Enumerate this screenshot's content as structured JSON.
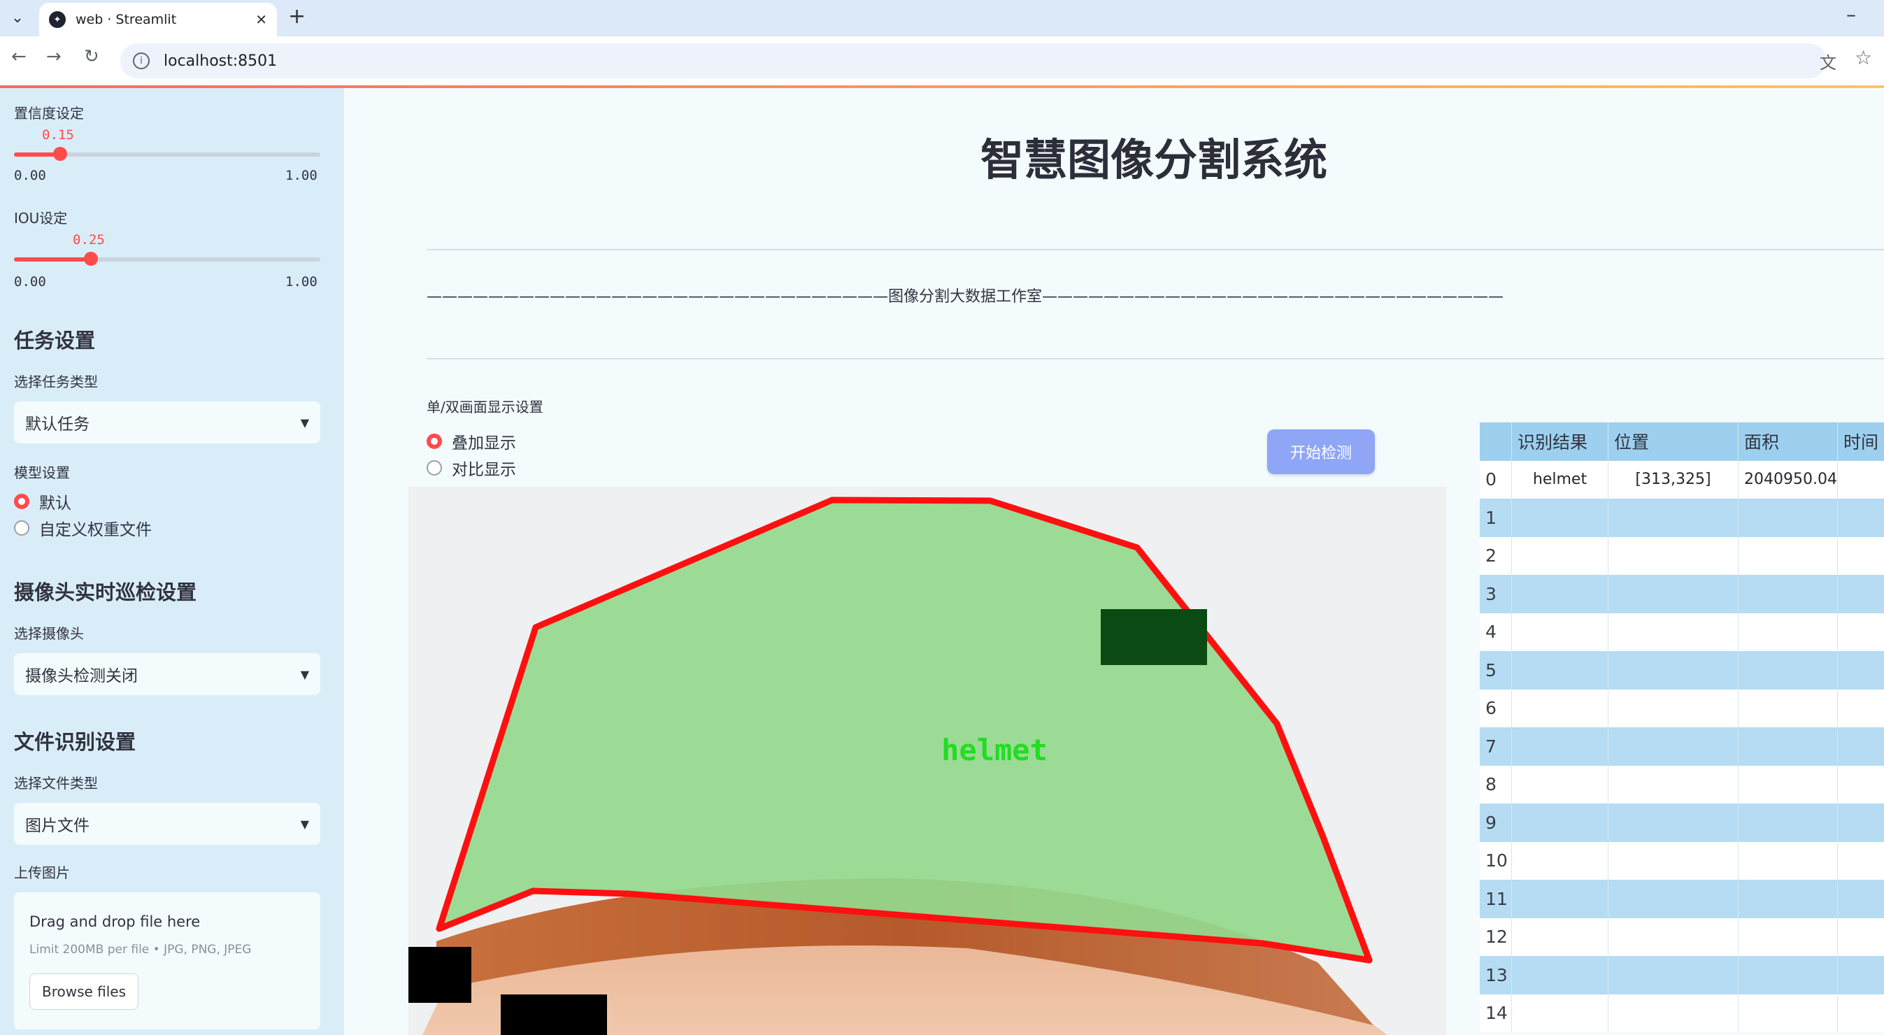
{
  "browser": {
    "tab_title": "web · Streamlit",
    "tab_favicon": "streamlit-logo",
    "url": "localhost:8501"
  },
  "sidebar": {
    "confidence": {
      "label": "置信度设定",
      "value": 0.15,
      "value_text": "0.15",
      "min": "0.00",
      "max": "1.00"
    },
    "iou": {
      "label": "IOU设定",
      "value": 0.25,
      "value_text": "0.25",
      "min": "0.00",
      "max": "1.00"
    },
    "task_heading": "任务设置",
    "task_type_label": "选择任务类型",
    "task_type_value": "默认任务",
    "model_label": "模型设置",
    "model_options": [
      "默认",
      "自定义权重文件"
    ],
    "model_selected": 0,
    "camera_heading": "摄像头实时巡检设置",
    "camera_label": "选择摄像头",
    "camera_value": "摄像头检测关闭",
    "file_heading": "文件识别设置",
    "file_type_label": "选择文件类型",
    "file_type_value": "图片文件",
    "upload_label": "上传图片",
    "upload_title": "Drag and drop file here",
    "upload_limit": "Limit 200MB per file • JPG, PNG, JPEG",
    "browse_label": "Browse files"
  },
  "main": {
    "title": "智慧图像分割系统",
    "banner": "——————————————————————————————图像分割大数据工作室——————————————————————————————",
    "display_label": "单/双画面显示设置",
    "display_options": [
      "叠加显示",
      "对比显示"
    ],
    "display_selected": 0,
    "start_button": "开始检测",
    "detection_label": "helmet",
    "colors": {
      "accent": "#ff4b4b",
      "mask": "#94d98e",
      "outline": "#ff1010",
      "label_text": "#22dd22"
    }
  },
  "table": {
    "columns": [
      "识别结果",
      "位置",
      "面积",
      "时间"
    ],
    "rows": [
      {
        "idx": "0",
        "result": "helmet",
        "position": "[313,325]",
        "area": "2040950.04",
        "time": ""
      },
      {
        "idx": "1",
        "result": "",
        "position": "",
        "area": "",
        "time": ""
      },
      {
        "idx": "2",
        "result": "",
        "position": "",
        "area": "",
        "time": ""
      },
      {
        "idx": "3",
        "result": "",
        "position": "",
        "area": "",
        "time": ""
      },
      {
        "idx": "4",
        "result": "",
        "position": "",
        "area": "",
        "time": ""
      },
      {
        "idx": "5",
        "result": "",
        "position": "",
        "area": "",
        "time": ""
      },
      {
        "idx": "6",
        "result": "",
        "position": "",
        "area": "",
        "time": ""
      },
      {
        "idx": "7",
        "result": "",
        "position": "",
        "area": "",
        "time": ""
      },
      {
        "idx": "8",
        "result": "",
        "position": "",
        "area": "",
        "time": ""
      },
      {
        "idx": "9",
        "result": "",
        "position": "",
        "area": "",
        "time": ""
      },
      {
        "idx": "10",
        "result": "",
        "position": "",
        "area": "",
        "time": ""
      },
      {
        "idx": "11",
        "result": "",
        "position": "",
        "area": "",
        "time": ""
      },
      {
        "idx": "12",
        "result": "",
        "position": "",
        "area": "",
        "time": ""
      },
      {
        "idx": "13",
        "result": "",
        "position": "",
        "area": "",
        "time": ""
      },
      {
        "idx": "14",
        "result": "",
        "position": "",
        "area": "",
        "time": ""
      }
    ]
  }
}
